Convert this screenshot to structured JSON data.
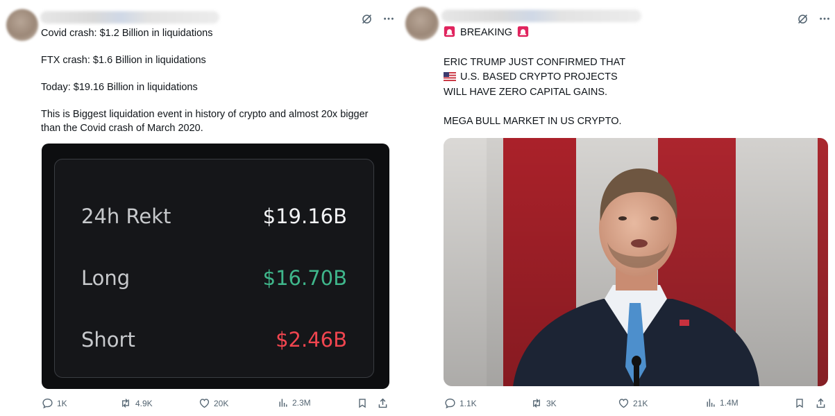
{
  "posts": [
    {
      "id": "left",
      "lines": [
        "Covid crash: $1.2 Billion in liquidations",
        "FTX crash: $1.6 Billion in liquidations",
        "Today: $19.16 Billion in liquidations",
        "This is Biggest liquidation event in history of crypto and almost 20x bigger",
        "than the Covid crash of March 2020."
      ],
      "card": {
        "rows": [
          {
            "label": "24h Rekt",
            "value": "$19.16B"
          },
          {
            "label": "Long",
            "value": "$16.70B"
          },
          {
            "label": "Short",
            "value": "$2.46B"
          }
        ]
      },
      "stats": {
        "replies": "1K",
        "reposts": "4.9K",
        "likes": "20K",
        "views": "2.3M"
      }
    },
    {
      "id": "right",
      "breaking_label": "BREAKING",
      "lines": [
        "ERIC TRUMP JUST CONFIRMED THAT",
        "U.S. BASED CRYPTO PROJECTS",
        "WILL HAVE ZERO CAPITAL GAINS.",
        "MEGA BULL MARKET IN US CRYPTO."
      ],
      "stats": {
        "replies": "1.1K",
        "reposts": "3K",
        "likes": "21K",
        "views": "1.4M"
      }
    }
  ],
  "colors": {
    "long_green": "#3fb68b",
    "short_red": "#f0454f",
    "action_gray": "#536471",
    "grok_icon": "grok-icon"
  }
}
